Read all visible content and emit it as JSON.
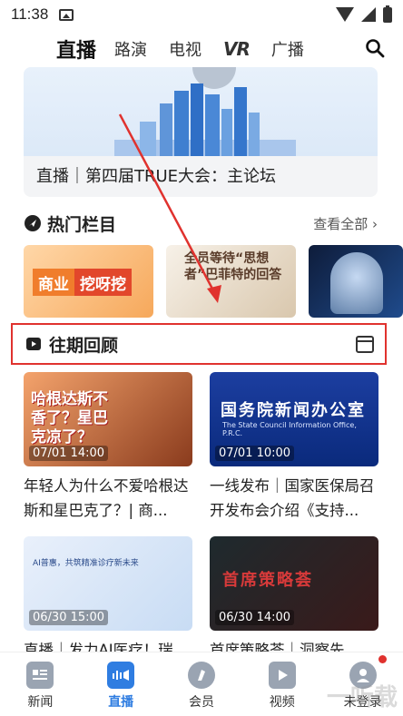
{
  "status_bar": {
    "time": "11:38"
  },
  "top_nav": {
    "tabs": [
      "直播",
      "路演",
      "电视",
      "VR",
      "广播"
    ],
    "active": "直播"
  },
  "hero": {
    "title": "直播｜第四届TRUE大会：主论坛"
  },
  "hot": {
    "title": "热门栏目",
    "more": "查看全部",
    "cards": [
      {
        "tag_a": "商业",
        "tag_b": "挖呀挖"
      },
      {
        "headline": "全员等待“思想者”巴菲特的回答"
      },
      {
        "headline": ""
      }
    ]
  },
  "review": {
    "title": "往期回顾"
  },
  "videos": [
    {
      "time": "07/01 14:00",
      "thumb_text": "哈根达斯不香了？星巴克凉了？",
      "caption": "年轻人为什么不爱哈根达斯和星巴克了？| 商..."
    },
    {
      "time": "07/01 10:00",
      "thumb_text": "国务院新闻办公室",
      "thumb_sub": "The State Council Information Office, P.R.C.",
      "caption": "一线发布｜国家医保局召开发布会介绍《支持..."
    },
    {
      "time": "06/30 15:00",
      "thumb_text": "AI普惠，共筑精准诊疗新未来",
      "caption": "直播｜发力AI医疗！瑞"
    },
    {
      "time": "06/30 14:00",
      "thumb_text": "首席策略荟",
      "caption": "首席策略荟｜洞察先"
    }
  ],
  "bottom_nav": [
    {
      "label": "新闻",
      "icon": "news-icon"
    },
    {
      "label": "直播",
      "icon": "live-icon"
    },
    {
      "label": "会员",
      "icon": "member-icon"
    },
    {
      "label": "视频",
      "icon": "video-icon"
    },
    {
      "label": "未登录",
      "icon": "user-icon"
    }
  ],
  "colors": {
    "accent": "#2f7de1",
    "highlight_border": "#e0322e",
    "arrow": "#e0322e"
  }
}
